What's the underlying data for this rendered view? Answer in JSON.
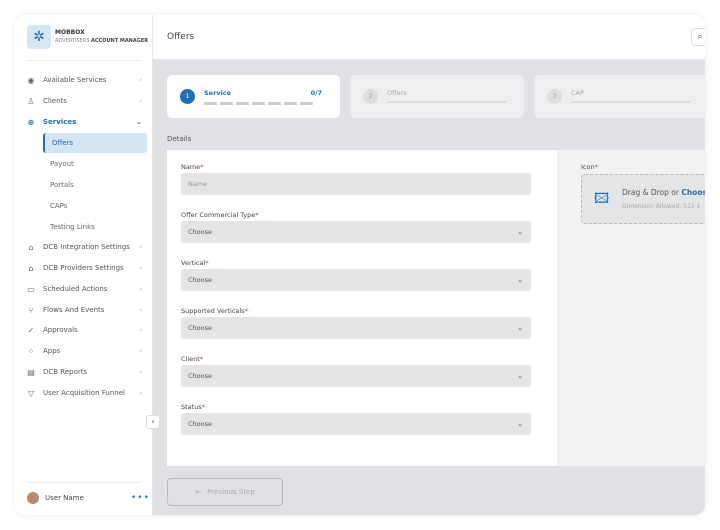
{
  "brand": {
    "name": "MOBBOX",
    "sub1": "ADVERTISERS",
    "sub2": "ACCOUNT MANAGER"
  },
  "sidebar": {
    "items": [
      {
        "label": "Available Services",
        "icon": "◉"
      },
      {
        "label": "Clients",
        "icon": "♙"
      },
      {
        "label": "Services",
        "icon": "⊕",
        "active": true
      },
      {
        "label": "DCB Integration Settings",
        "icon": "⌂"
      },
      {
        "label": "DCB Providers Settings",
        "icon": "⌂"
      },
      {
        "label": "Scheduled Actions",
        "icon": "▭"
      },
      {
        "label": "Flows And Events",
        "icon": "⑂"
      },
      {
        "label": "Approvals",
        "icon": "✓"
      },
      {
        "label": "Apps",
        "icon": "⁘"
      },
      {
        "label": "DCB Reports",
        "icon": "▤"
      },
      {
        "label": "User Acquisition Funnel",
        "icon": "▽"
      }
    ],
    "subitems": [
      {
        "label": "Offers",
        "selected": true
      },
      {
        "label": "Payout"
      },
      {
        "label": "Portals"
      },
      {
        "label": "CAPs"
      },
      {
        "label": "Testing Links"
      }
    ],
    "user": "User Name"
  },
  "header": {
    "title": "Offers"
  },
  "steps": [
    {
      "num": "1",
      "label": "Service",
      "count": "0/7",
      "progress": 0
    },
    {
      "num": "2",
      "label": "Offers"
    },
    {
      "num": "3",
      "label": "CAP"
    }
  ],
  "details_label": "Details",
  "fields": [
    {
      "label": "Name",
      "placeholder": "Name"
    },
    {
      "label": "Offer Commercial Type",
      "value": "Choose"
    },
    {
      "label": "Vertical",
      "value": "Choose"
    },
    {
      "label": "Supported Verticals",
      "value": "Choose"
    },
    {
      "label": "Client",
      "value": "Choose"
    },
    {
      "label": "Status",
      "value": "Choose"
    }
  ],
  "icon_upload": {
    "label": "Icon",
    "text": "Drag & Drop or ",
    "link": "Choose",
    "hint": "Dimension Allowed: 512 x"
  },
  "prev_button": "Previous Step",
  "accent": "#1f6fb6"
}
